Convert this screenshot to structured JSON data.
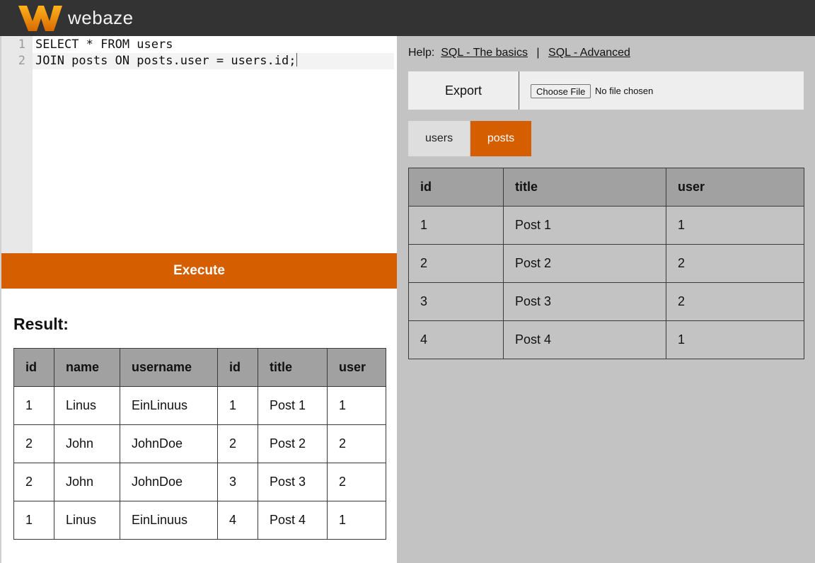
{
  "app": {
    "name": "webaze"
  },
  "editor": {
    "lines": [
      {
        "num": "1",
        "text": "SELECT * FROM users"
      },
      {
        "num": "2",
        "text": "JOIN posts ON posts.user = users.id;"
      }
    ],
    "execute_label": "Execute"
  },
  "result": {
    "title": "Result:",
    "columns": [
      "id",
      "name",
      "username",
      "id",
      "title",
      "user"
    ],
    "rows": [
      [
        "1",
        "Linus",
        "EinLinuus",
        "1",
        "Post 1",
        "1"
      ],
      [
        "2",
        "John",
        "JohnDoe",
        "2",
        "Post 2",
        "2"
      ],
      [
        "2",
        "John",
        "JohnDoe",
        "3",
        "Post 3",
        "2"
      ],
      [
        "1",
        "Linus",
        "EinLinuus",
        "4",
        "Post 4",
        "1"
      ]
    ]
  },
  "help": {
    "label": "Help:",
    "link1": "SQL - The basics",
    "separator": "|",
    "link2": "SQL - Advanced"
  },
  "export": {
    "label": "Export",
    "file_button": "Choose File",
    "file_status": "No file chosen"
  },
  "tabs": [
    {
      "label": "users",
      "active": false
    },
    {
      "label": "posts",
      "active": true
    }
  ],
  "table_view": {
    "columns": [
      "id",
      "title",
      "user"
    ],
    "rows": [
      [
        "1",
        "Post 1",
        "1"
      ],
      [
        "2",
        "Post 2",
        "2"
      ],
      [
        "3",
        "Post 3",
        "2"
      ],
      [
        "4",
        "Post 4",
        "1"
      ]
    ]
  },
  "colors": {
    "accent": "#d45e00",
    "header_bg": "#333333",
    "panel_bg": "#c3c3c3",
    "table_header_bg": "#a1a1a1"
  }
}
